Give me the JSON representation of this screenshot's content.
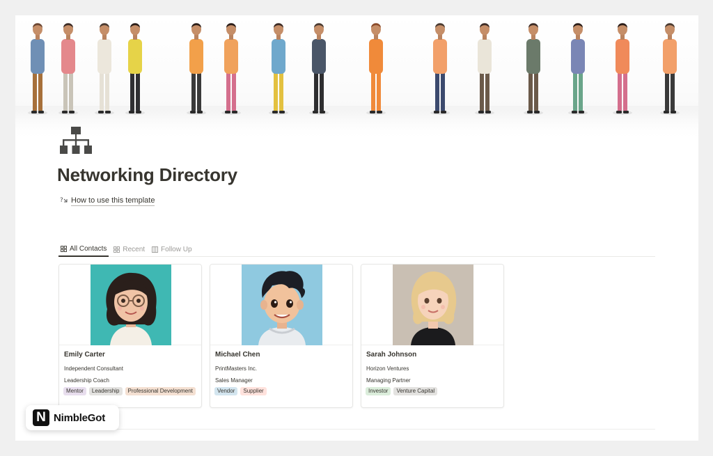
{
  "page": {
    "title": "Networking Directory",
    "icon": "sitemap-icon",
    "howto_label": "How to use this template",
    "howto_icon": "help-icon"
  },
  "tabs": [
    {
      "label": "All Contacts",
      "icon": "gallery-icon",
      "active": true
    },
    {
      "label": "Recent",
      "icon": "gallery-icon",
      "active": false
    },
    {
      "label": "Follow Up",
      "icon": "board-icon",
      "active": false
    }
  ],
  "contacts": [
    {
      "name": "Emily Carter",
      "line1": "Independent Consultant",
      "line2": "Leadership Coach",
      "tags": [
        {
          "label": "Mentor",
          "color": "#e8deee"
        },
        {
          "label": "Leadership",
          "color": "#e3e2e0"
        },
        {
          "label": "Professional Development",
          "color": "#f4e0d2"
        }
      ],
      "cover_bg": "#3fb8b3"
    },
    {
      "name": "Michael Chen",
      "line1": "PrintMasters Inc.",
      "line2": "Sales Manager",
      "tags": [
        {
          "label": "Vendor",
          "color": "#d3e5ef"
        },
        {
          "label": "Supplier",
          "color": "#ffe2dd"
        }
      ],
      "cover_bg": "#8fc9e0"
    },
    {
      "name": "Sarah Johnson",
      "line1": "Horizon Ventures",
      "line2": "Managing Partner",
      "tags": [
        {
          "label": "Investor",
          "color": "#dbeddb"
        },
        {
          "label": "Venture Capital",
          "color": "#e3e2e0"
        }
      ],
      "cover_bg": "#c9bfb3"
    }
  ],
  "brand": {
    "logo_letter": "N",
    "name": "NimbleGot"
  }
}
